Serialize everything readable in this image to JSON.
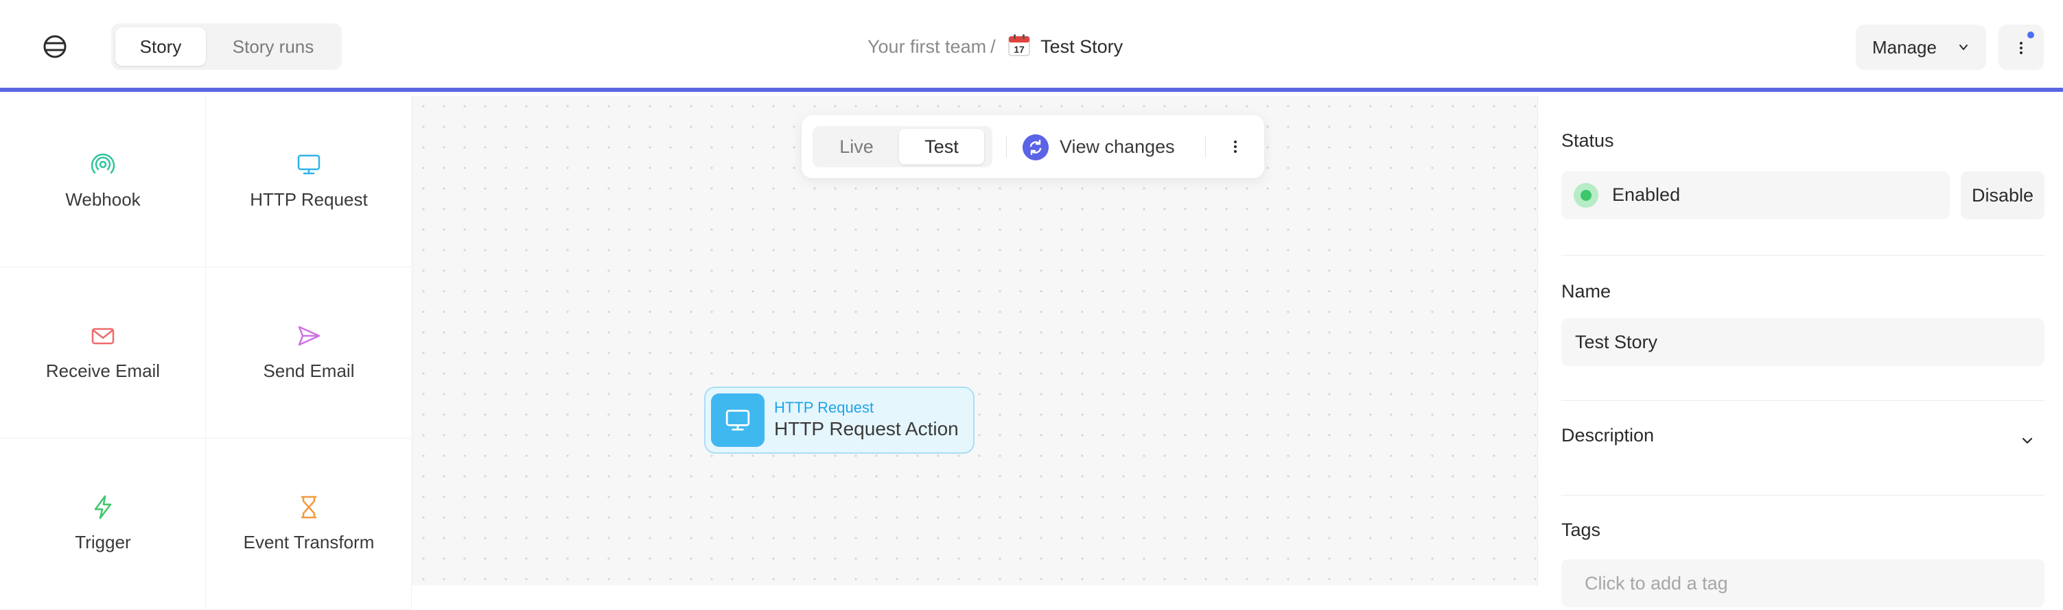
{
  "header": {
    "logo_icon": "tines-logo-icon",
    "tabs": [
      {
        "label": "Story",
        "active": true
      },
      {
        "label": "Story runs",
        "active": false
      }
    ],
    "breadcrumb": {
      "team": "Your first team",
      "separator": "/",
      "story_icon": "calendar-emoji-icon",
      "story": "Test Story"
    },
    "manage_label": "Manage",
    "accent_color": "#5a67e0"
  },
  "palette": {
    "items": [
      {
        "label": "Webhook",
        "icon": "webhook-icon",
        "color": "#2fc49b"
      },
      {
        "label": "HTTP Request",
        "icon": "monitor-icon",
        "color": "#2fb3ea"
      },
      {
        "label": "Receive Email",
        "icon": "envelope-icon",
        "color": "#f06a6a"
      },
      {
        "label": "Send Email",
        "icon": "send-icon",
        "color": "#d070e6"
      },
      {
        "label": "Trigger",
        "icon": "lightning-icon",
        "color": "#3ec76a"
      },
      {
        "label": "Event Transform",
        "icon": "hourglass-icon",
        "color": "#f29a3c"
      }
    ]
  },
  "canvas": {
    "modes": [
      {
        "label": "Live",
        "active": false
      },
      {
        "label": "Test",
        "active": true
      }
    ],
    "view_changes_label": "View changes",
    "node": {
      "type": "HTTP Request",
      "name": "HTTP Request Action",
      "color": "#3fb8f0"
    }
  },
  "panel": {
    "status_label": "Status",
    "status_value": "Enabled",
    "disable_label": "Disable",
    "name_label": "Name",
    "name_value": "Test Story",
    "description_label": "Description",
    "tags_label": "Tags",
    "tags_placeholder": "Click to add a tag"
  }
}
